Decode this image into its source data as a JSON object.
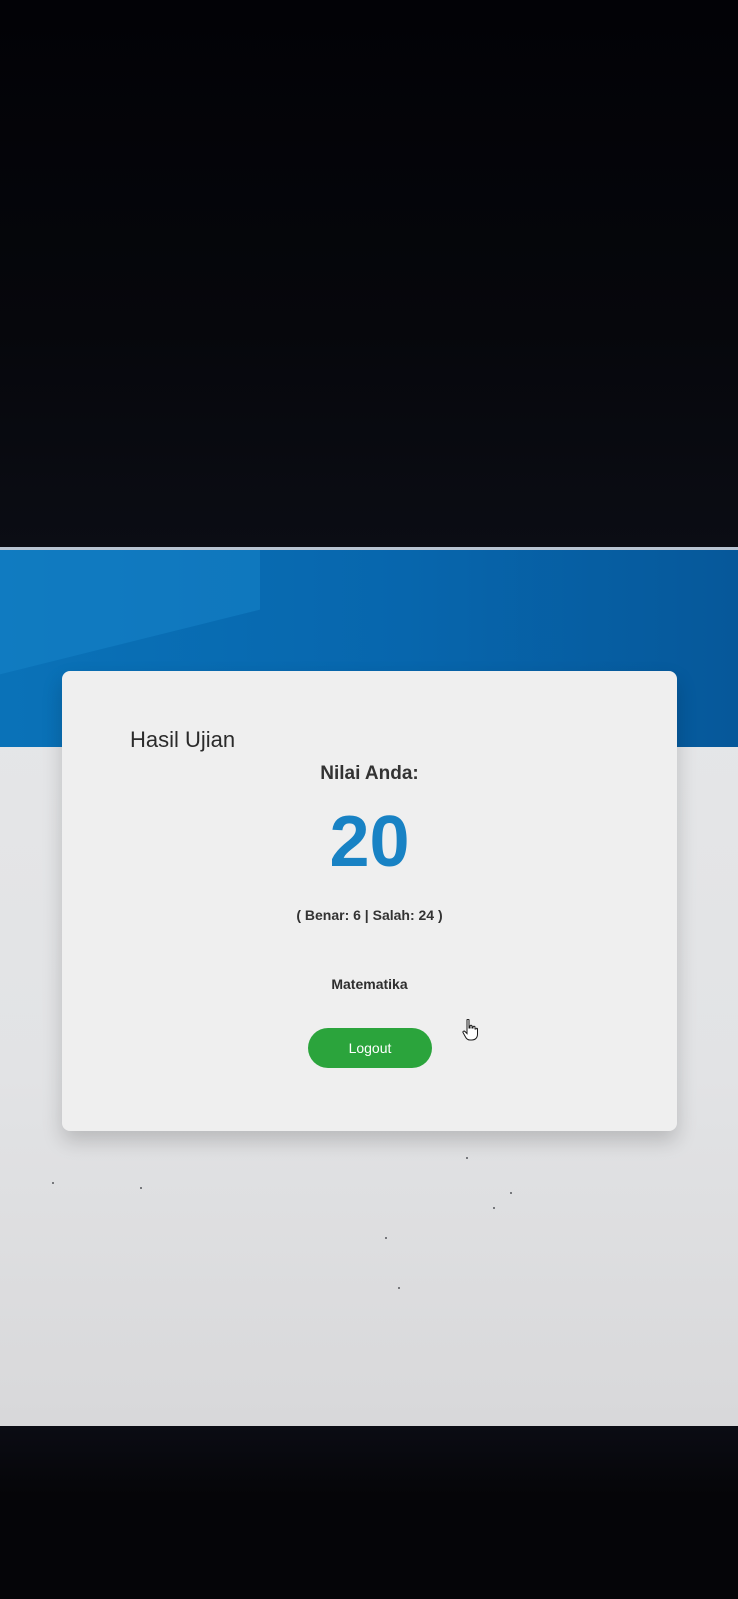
{
  "page": {
    "title": "Hasil Ujian"
  },
  "result": {
    "score_label": "Nilai Anda:",
    "score_value": "20",
    "detail": "( Benar: 6 | Salah: 24 )",
    "subject": "Matematika"
  },
  "actions": {
    "logout_label": "Logout"
  },
  "colors": {
    "banner": "#0766ad",
    "score": "#1882c4",
    "logout_button": "#2ba43c",
    "card": "#efefef"
  },
  "icons": {
    "cursor": "hand-pointer-icon"
  }
}
